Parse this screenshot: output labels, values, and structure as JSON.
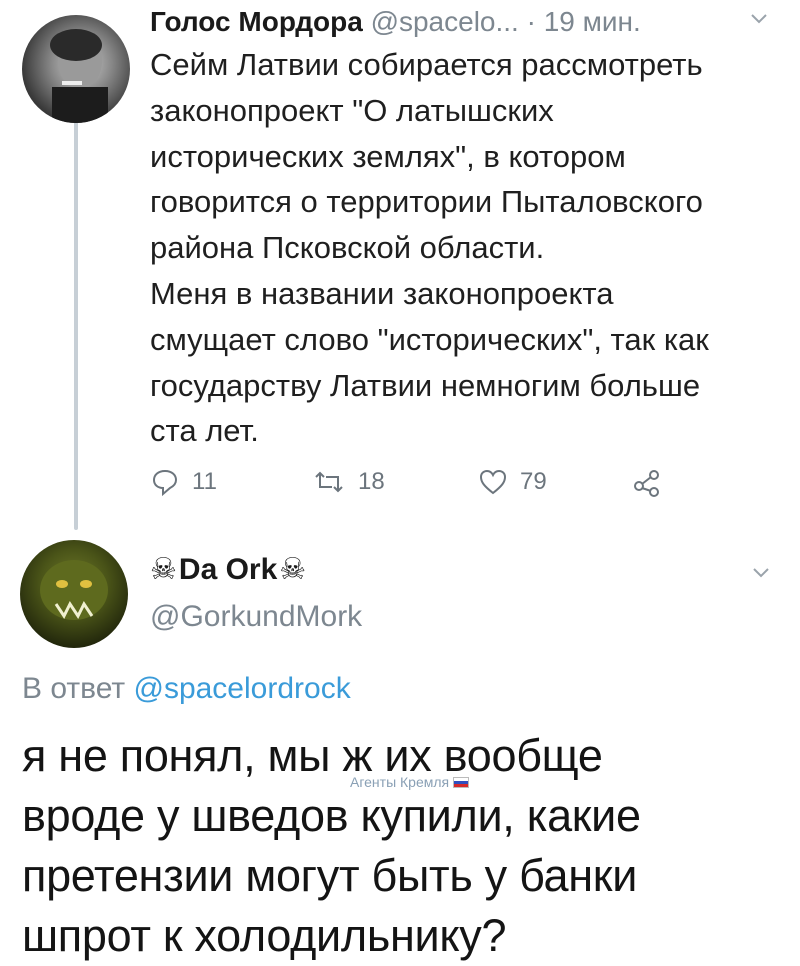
{
  "tweet1": {
    "author_name": "Голос Мордора",
    "handle": "@spacelo...",
    "separator": "·",
    "time": "19 мин.",
    "text_lines": [
      "Сейм Латвии собирается рассмотреть",
      "законопроект \"О латышских",
      "исторических землях\", в котором",
      "говорится о территории Пыталовского",
      "района Псковской области.",
      "Меня в названии законопроекта",
      "смущает слово \"исторических\", так как",
      "государству Латвии немногим больше",
      "ста лет."
    ],
    "actions": {
      "reply_count": "11",
      "retweet_count": "18",
      "like_count": "79"
    }
  },
  "tweet2": {
    "author_name": "Da Ork",
    "handle": "@GorkundMork",
    "reply_prefix": "В ответ",
    "reply_mention": "@spacelordrock",
    "text_lines": [
      "я не понял, мы ж их вообще",
      "вроде у шведов купили, какие",
      "претензии могут быть у банки",
      "шпрот к холодильнику?"
    ]
  },
  "watermark": "Агенты Кремля",
  "icons": {
    "reply": "reply-icon",
    "retweet": "retweet-icon",
    "like": "heart-icon",
    "share": "share-icon",
    "more": "chevron-down-icon",
    "name_decoration": "skull-crossbones-icon",
    "watermark_flag": "russian-flag-icon"
  },
  "colors": {
    "secondary_text": "#7d8790",
    "mention": "#3a9bd9",
    "thread_line": "#c7cfd6"
  }
}
